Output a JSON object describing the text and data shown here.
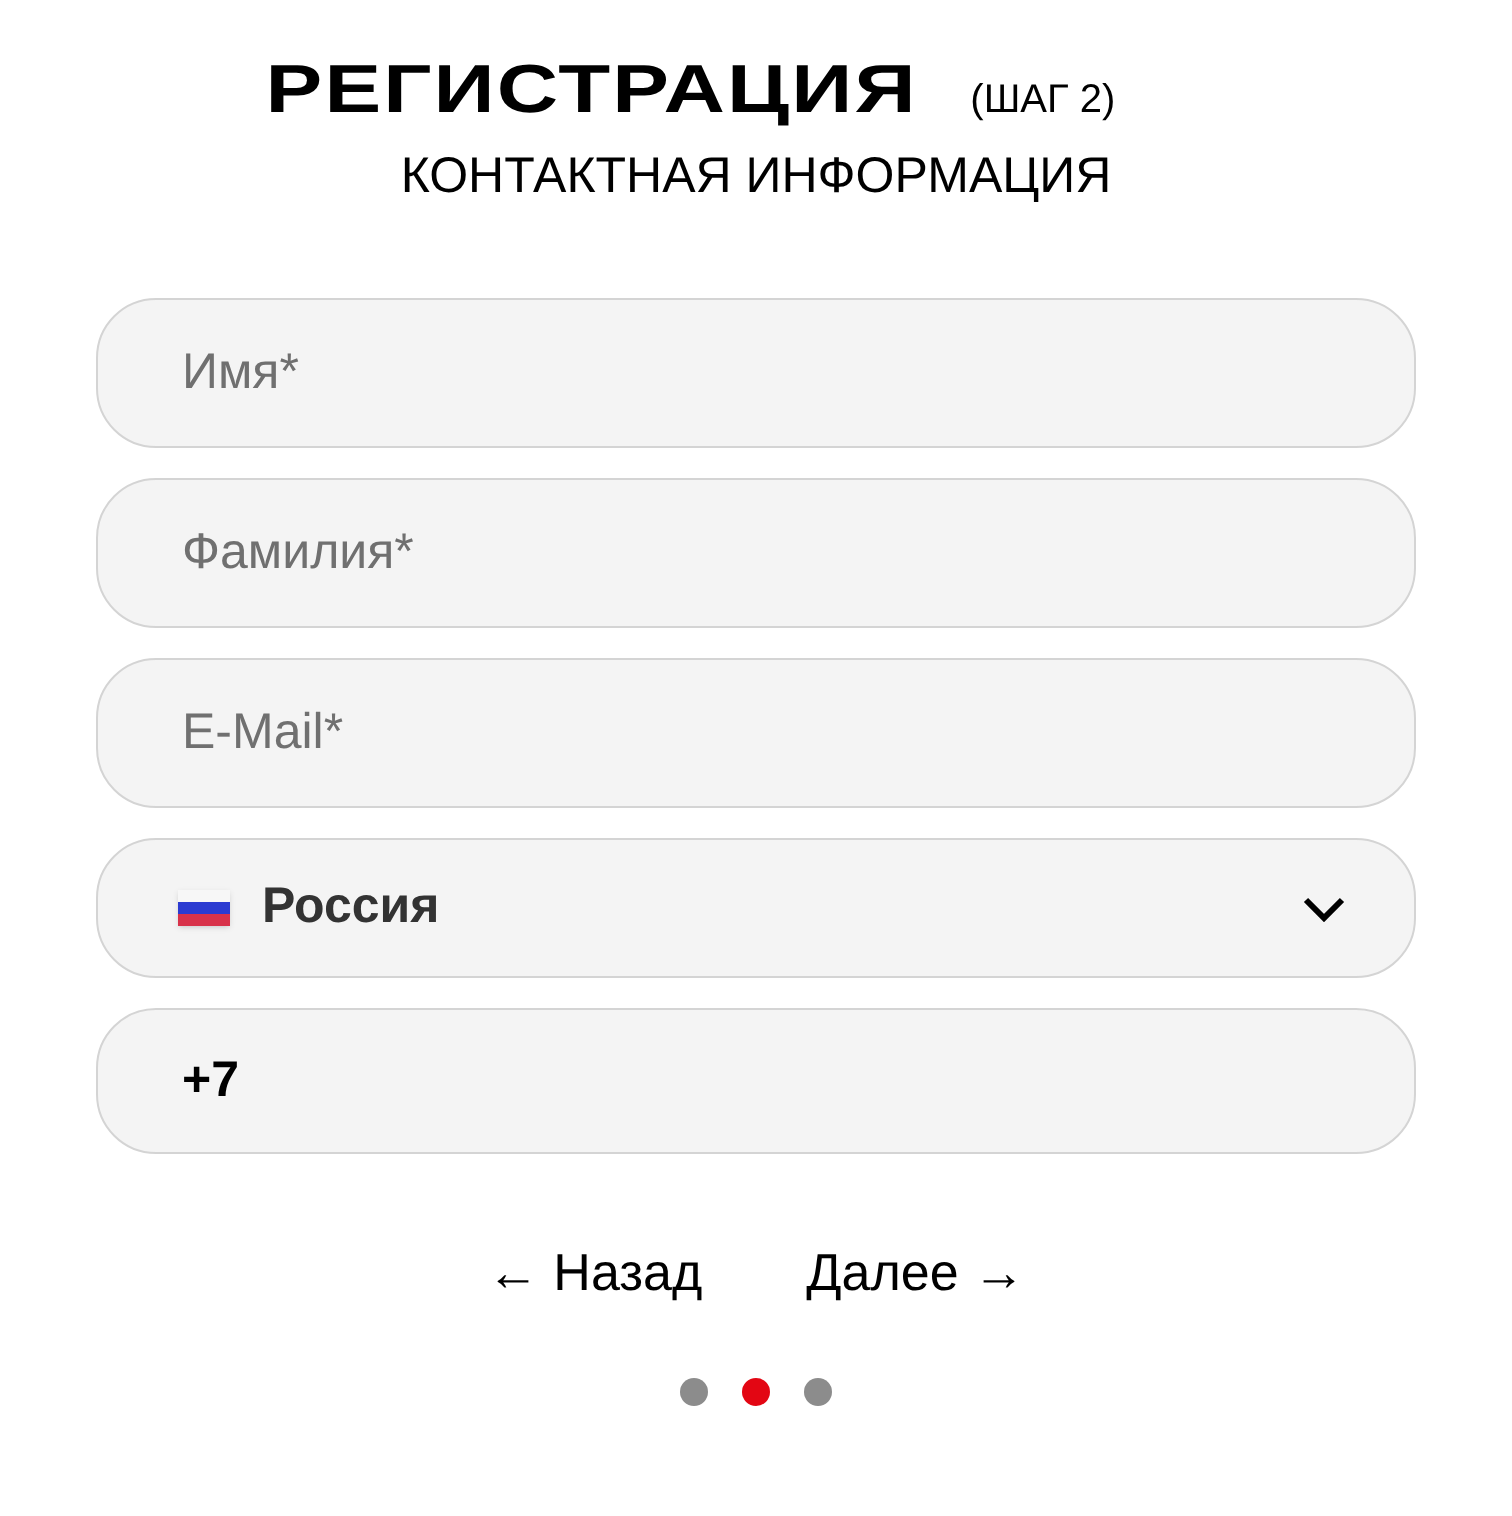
{
  "header": {
    "title": "РЕГИСТРАЦИЯ",
    "step": "(ШАГ 2)",
    "subtitle": "КОНТАКТНАЯ ИНФОРМАЦИЯ"
  },
  "fields": [
    {
      "kind": "text",
      "placeholder": "Имя*"
    },
    {
      "kind": "text",
      "placeholder": "Фамилия*"
    },
    {
      "kind": "text",
      "placeholder": "E-Mail*"
    },
    {
      "kind": "country",
      "value": "Россия"
    },
    {
      "kind": "phone",
      "value": "+7"
    }
  ],
  "nav": {
    "back": "← Назад",
    "next": "Далее →"
  },
  "steps": [
    {
      "selected": false
    },
    {
      "selected": true
    },
    {
      "selected": false
    }
  ]
}
